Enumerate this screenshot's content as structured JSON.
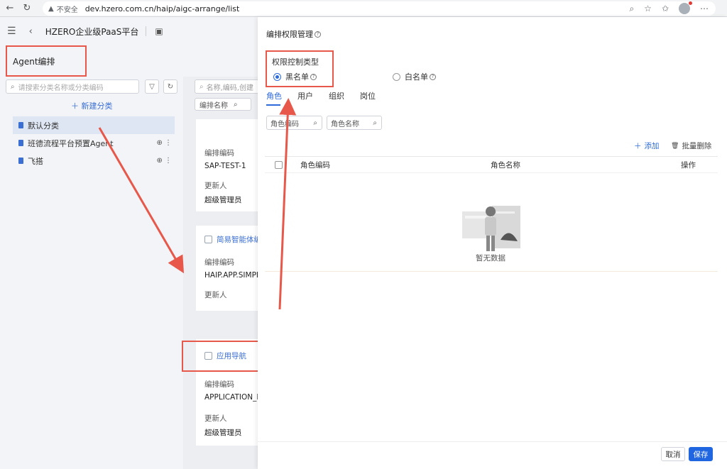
{
  "browser": {
    "insecure_label": "不安全",
    "url": "dev.hzero.com.cn/haip/aigc-arrange/list"
  },
  "app": {
    "title": "HZERO企业级PaaS平台",
    "page_title": "Agent编排",
    "category_search_placeholder": "请搜索分类名称或分类编码",
    "new_category": "新建分类",
    "categories": [
      {
        "label": "默认分类",
        "active": true
      },
      {
        "label": "班德流程平台预置Agent",
        "active": false
      },
      {
        "label": "飞搭",
        "active": false
      }
    ],
    "list_search_placeholder": "名称,编码,创建",
    "list_filter": "编排名称",
    "cards": [
      {
        "code_label": "编排编码",
        "code": "SAP-TEST-1",
        "updater_label": "更新人",
        "updater": "超级管理员"
      },
      {
        "title": "简易智能体编",
        "code_label": "编排编码",
        "code": "HAIP.APP.SIMPL",
        "updater_label": "更新人"
      },
      {
        "title": "应用导航",
        "code_label": "编排编码",
        "code": "APPLICATION_N",
        "updater_label": "更新人",
        "updater": "超级管理员"
      }
    ]
  },
  "drawer": {
    "title": "编排权限管理",
    "perm_type_label": "权限控制类型",
    "blacklist_label": "黑名单",
    "whitelist_label": "白名单",
    "tabs": [
      "角色",
      "用户",
      "组织",
      "岗位"
    ],
    "role_code_placeholder": "角色编码",
    "role_name_placeholder": "角色名称",
    "add_label": "添加",
    "batch_delete_label": "批量删除",
    "columns": {
      "code": "角色编码",
      "name": "角色名称",
      "op": "操作"
    },
    "empty_text": "暂无数据",
    "cancel_label": "取消",
    "save_label": "保存"
  },
  "colors": {
    "accent": "#2d6bdc",
    "annotation": "#e8584a"
  }
}
